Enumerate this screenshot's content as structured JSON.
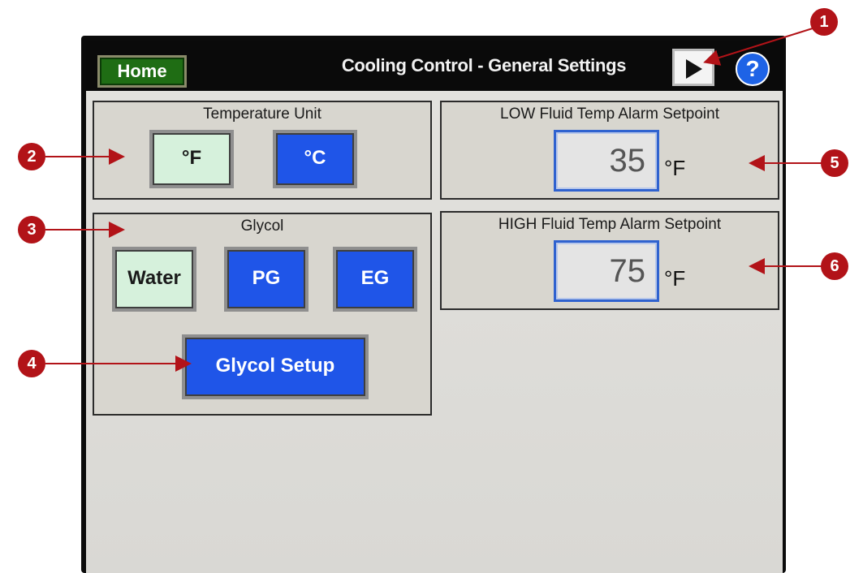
{
  "header": {
    "home_label": "Home",
    "title": "Cooling Control - General Settings",
    "next_icon": "play-triangle-icon",
    "help_label": "?"
  },
  "temperature_unit": {
    "title": "Temperature Unit",
    "options": [
      "°F",
      "°C"
    ],
    "selected": "°F"
  },
  "glycol": {
    "title": "Glycol",
    "options": [
      "Water",
      "PG",
      "EG"
    ],
    "selected": "Water",
    "setup_label": "Glycol Setup"
  },
  "low_alarm": {
    "title": "LOW Fluid Temp Alarm Setpoint",
    "value": "35",
    "unit": "°F"
  },
  "high_alarm": {
    "title": "HIGH Fluid Temp Alarm Setpoint",
    "value": "75",
    "unit": "°F"
  },
  "callouts": [
    "1",
    "2",
    "3",
    "4",
    "5",
    "6"
  ],
  "colors": {
    "callout": "#b21318",
    "selected_button": "#d6f1dc",
    "unselected_button": "#1f55e8",
    "home_button": "#1f6d14",
    "help_button": "#1e63e6"
  }
}
